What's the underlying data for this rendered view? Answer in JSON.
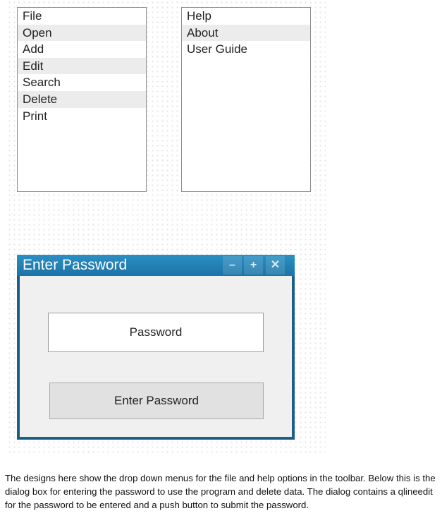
{
  "file_menu": {
    "items": [
      {
        "label": "File"
      },
      {
        "label": "Open"
      },
      {
        "label": "Add"
      },
      {
        "label": "Edit"
      },
      {
        "label": "Search"
      },
      {
        "label": "Delete"
      },
      {
        "label": "Print"
      }
    ]
  },
  "help_menu": {
    "items": [
      {
        "label": "Help"
      },
      {
        "label": "About"
      },
      {
        "label": "User Guide"
      }
    ]
  },
  "dialog": {
    "title": "Enter Password",
    "controls": {
      "minimize": "–",
      "maximize": "+",
      "close": "✕"
    },
    "password_field": "Password",
    "submit_label": "Enter Password"
  },
  "caption": "The designs here show the drop down menus for the file and help options in the toolbar. Below this is the dialog box for entering the password to use the program and delete data. The dialog contains a qlineedit for the password to be entered and a push button to submit the password."
}
